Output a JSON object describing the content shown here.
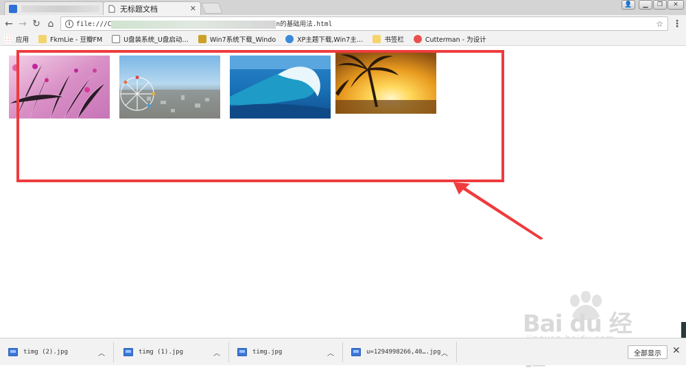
{
  "tabs": [
    {
      "title": "",
      "active": false
    },
    {
      "title": "无标题文档",
      "active": true
    }
  ],
  "toolbar": {
    "url_prefix": "file:///C",
    "url_suffix": "n的基础用法.html"
  },
  "bookmarks": [
    {
      "label": "应用",
      "icon": "apps-grid-icon"
    },
    {
      "label": "FkmLie - 豆瓣FM",
      "icon": "douban-icon"
    },
    {
      "label": "U盘装系统_U盘启动…",
      "icon": "page-icon"
    },
    {
      "label": "Win7系统下载_Windo",
      "icon": "cube-icon"
    },
    {
      "label": "XP主题下载,Win7主…",
      "icon": "theme-icon"
    },
    {
      "label": "书签栏",
      "icon": "folder-icon"
    },
    {
      "label": "Cutterman - 为设计",
      "icon": "cutterman-icon"
    }
  ],
  "photos": [
    {
      "subject": "pink-flowers"
    },
    {
      "subject": "ferris-wheel-city"
    },
    {
      "subject": "ocean-wave"
    },
    {
      "subject": "sunset-palm"
    }
  ],
  "watermark": {
    "main": "Bai du 经验",
    "sub": "jingyan.baidu.com"
  },
  "downloads": [
    {
      "name": "timg (2).jpg"
    },
    {
      "name": "timg (1).jpg"
    },
    {
      "name": "timg.jpg"
    },
    {
      "name": "u=1294998266,40….jpg"
    }
  ],
  "download_bar": {
    "show_all": "全部显示"
  },
  "colors": {
    "annotation": "#ef3b3d"
  }
}
